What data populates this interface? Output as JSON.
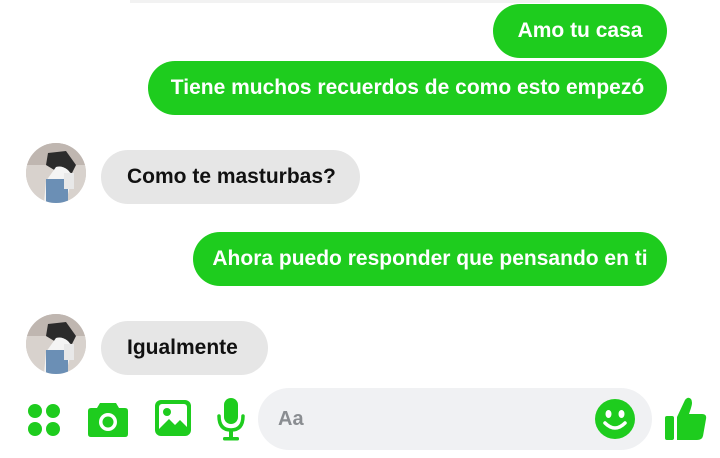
{
  "messages": [
    {
      "sender": "me",
      "text": "Amo tu casa"
    },
    {
      "sender": "me",
      "text": "Tiene muchos recuerdos de como esto empezó"
    },
    {
      "sender": "them",
      "text": "Como te masturbas?"
    },
    {
      "sender": "me",
      "text": "Ahora puedo responder que pensando en ti"
    },
    {
      "sender": "them",
      "text": "Igualmente"
    }
  ],
  "composer": {
    "placeholder": "Aa",
    "icons": [
      "apps-icon",
      "camera-icon",
      "image-icon",
      "microphone-icon",
      "emoji-icon",
      "thumbs-up-icon"
    ]
  },
  "colors": {
    "accent": "#1ecc1e",
    "incoming_bubble": "#e6e6e6",
    "input_bg": "#f0f1f3"
  }
}
